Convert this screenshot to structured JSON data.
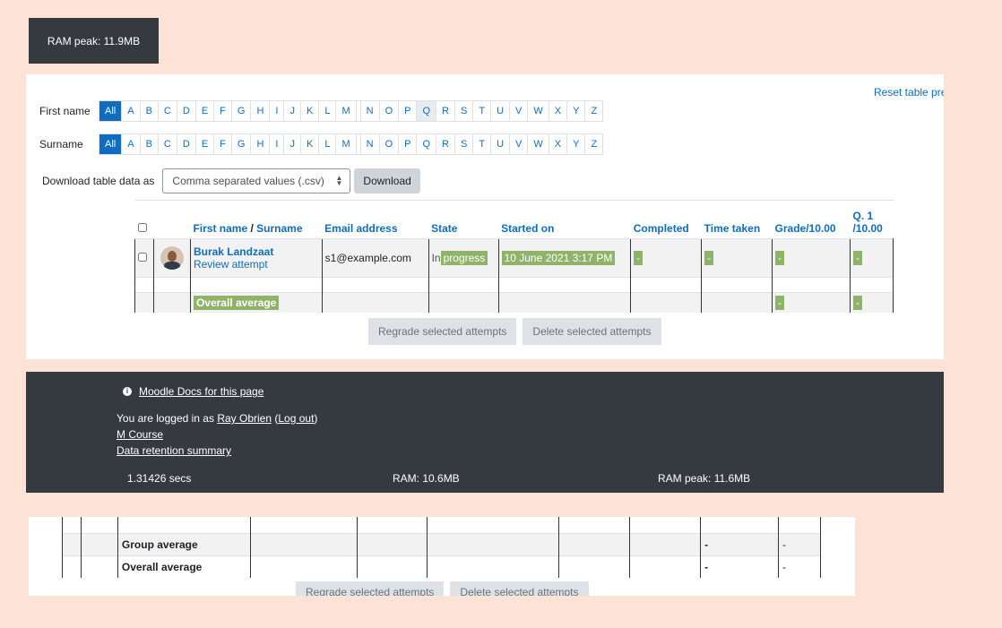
{
  "perf_top": {
    "ram_peak": "RAM peak: 11.9MB"
  },
  "reset_link": "Reset table preferences",
  "initials": {
    "firstname_label": "First name",
    "surname_label": "Surname",
    "all_label": "All",
    "letters": [
      "A",
      "B",
      "C",
      "D",
      "E",
      "F",
      "G",
      "H",
      "I",
      "J",
      "K",
      "L",
      "M",
      "N",
      "O",
      "P",
      "Q",
      "R",
      "S",
      "T",
      "U",
      "V",
      "W",
      "X",
      "Y",
      "Z"
    ]
  },
  "download": {
    "label": "Download table data as",
    "format": "Comma separated values (.csv)",
    "button": "Download"
  },
  "table": {
    "headers": {
      "firstname": "First name",
      "sep": " / ",
      "surname": "Surname",
      "email": "Email address",
      "state": "State",
      "started": "Started on",
      "completed": "Completed",
      "time_taken": "Time taken",
      "grade": "Grade/10.00",
      "q1_line1": "Q. 1",
      "q1_line2": "/10.00"
    },
    "student": {
      "name": "Burak Landzaat",
      "review": "Review attempt",
      "email": "s1@example.com",
      "state_prefix": "In",
      "state_highlight": "progress",
      "started": "10 June 2021 3:17 PM",
      "completed": "-",
      "time_taken": "-",
      "grade": "-",
      "q1": "-"
    },
    "overall": {
      "label": "Overall average",
      "grade": "-",
      "q1": "-"
    }
  },
  "bulk": {
    "regrade": "Regrade selected attempts",
    "delete": "Delete selected attempts"
  },
  "footer": {
    "docs_link": "Moodle Docs for this page",
    "logged_prefix": "You are logged in as ",
    "user": "Ray Obrien",
    "logout_open": " (",
    "logout": "Log out",
    "logout_close": ")",
    "course": "M Course",
    "retention": "Data retention summary",
    "secs": "1.31426 secs",
    "ram": "RAM: 10.6MB",
    "ram_peak": "RAM peak: 11.6MB"
  },
  "lower": {
    "group_avg": "Group average",
    "overall_avg": "Overall average",
    "dash": "-",
    "regrade": "Regrade selected attempts",
    "delete": "Delete selected attempts"
  }
}
